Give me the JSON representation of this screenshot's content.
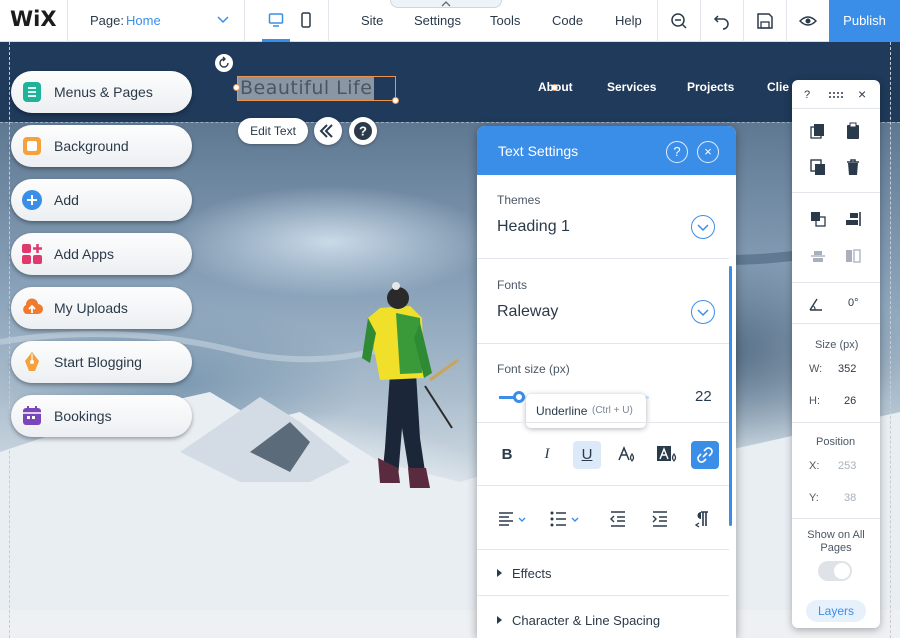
{
  "topbar": {
    "logo": "WiX",
    "page_label": "Page:",
    "page_value": "Home",
    "menu": [
      "Site",
      "Settings",
      "Tools",
      "Code",
      "Help"
    ],
    "publish": "Publish",
    "icons": [
      "desktop-icon",
      "mobile-icon",
      "zoom-out-icon",
      "undo-icon",
      "save-icon",
      "preview-icon"
    ]
  },
  "site": {
    "title": "Beautiful Life",
    "nav": [
      "About",
      "Services",
      "Projects",
      "Clie"
    ],
    "edit_text": "Edit Text"
  },
  "left_panel": {
    "items": [
      {
        "label": "Menus & Pages",
        "icon": "menus-pages-icon",
        "color": "#21b39a"
      },
      {
        "label": "Background",
        "icon": "background-icon",
        "color": "#f5a13c"
      },
      {
        "label": "Add",
        "icon": "add-icon",
        "color": "#3b8ee8"
      },
      {
        "label": "Add Apps",
        "icon": "add-apps-icon",
        "color": "#e0396e"
      },
      {
        "label": "My Uploads",
        "icon": "uploads-icon",
        "color": "#f07a2e"
      },
      {
        "label": "Start Blogging",
        "icon": "blog-icon",
        "color": "#f5a13c"
      },
      {
        "label": "Bookings",
        "icon": "bookings-icon",
        "color": "#7a46b8"
      }
    ]
  },
  "text_settings": {
    "title": "Text Settings",
    "help": "?",
    "close": "×",
    "themes_label": "Themes",
    "themes_value": "Heading 1",
    "fonts_label": "Fonts",
    "fonts_value": "Raleway",
    "font_size_label": "Font size (px)",
    "font_size_value": "22",
    "tooltip_title": "Underline",
    "tooltip_shortcut": "(Ctrl + U)",
    "bold": "B",
    "italic": "I",
    "underline": "U",
    "effects": "Effects",
    "char_spacing": "Character & Line Spacing"
  },
  "right_toolbar": {
    "help": "?",
    "close": "×",
    "rotation": "0°",
    "size_label": "Size (px)",
    "w_label": "W:",
    "w_value": "352",
    "h_label": "H:",
    "h_value": "26",
    "position_label": "Position",
    "x_label": "X:",
    "x_value": "253",
    "y_label": "Y:",
    "y_value": "38",
    "show_all_pages": "Show on All Pages",
    "layers": "Layers"
  },
  "colors": {
    "accent": "#3b8ee8",
    "site_header": "#1f3a5a",
    "selection": "#f0934a"
  }
}
